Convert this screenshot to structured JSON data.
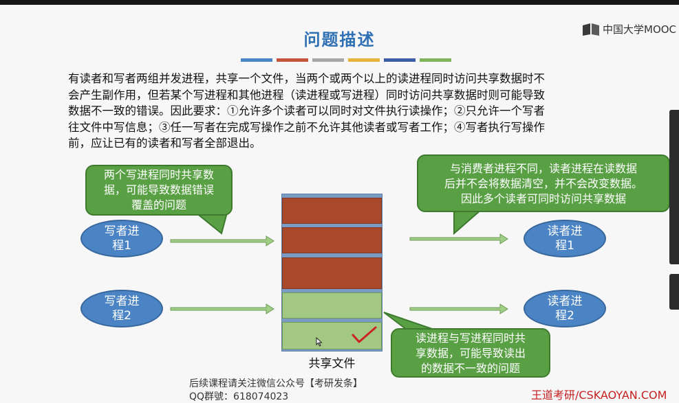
{
  "logo": {
    "text": "中国大学MOOC",
    "icon": "mooc-logo-icon"
  },
  "slide": {
    "title": "问题描述",
    "color_bar": [
      "#4a86c5",
      "#c5553a",
      "#a7a7a7",
      "#e6b33b",
      "#3c5fa8",
      "#7fb55a"
    ],
    "description": [
      "有读者和写者两组并发进程，共享一个文件，当两个或两个以上的读进程同时访问共享数据时不",
      "会产生副作用，但若某个写进程和其他进程（读进程或写进程）同时访问共享数据时则可能导致",
      "数据不一致的错误。因此要求：①允许多个读者可以同时对文件执行读操作；②只允许一个写者",
      "往文件中写信息；③任一写者在完成写操作之前不允许其他读者或写者工作；④写者执行写操作",
      "前，应让已有的读者和写者全部退出。"
    ],
    "bubbles": {
      "writers_conflict": [
        "两个写进程同时共享数",
        "据，可能导致数据错误",
        "覆盖的问题"
      ],
      "readers_share": [
        "与消费者进程不同，读者进程在读数据",
        "后并不会将数据清空，并不会改变数据。",
        "因此多个读者可同时访问共享数据"
      ],
      "read_write_conflict": [
        "读进程与写进程同时共",
        "享数据，可能导致读出",
        "的数据不一致的问题"
      ]
    },
    "processes": {
      "writer1": [
        "写者进",
        "程1"
      ],
      "writer2": [
        "写者进",
        "程2"
      ],
      "reader1": [
        "读者进",
        "程1"
      ],
      "reader2": [
        "读者进",
        "程2"
      ]
    },
    "shared_file_label": "共享文件",
    "check_mark": "✓",
    "footer": [
      "后续课程请关注微信公众号【考研发条】",
      "QQ群號：618074023"
    ],
    "watermark": "王道考研/CSKAOYAN.COM",
    "colors": {
      "title": "#2f6fb3",
      "bubble": "#59a045",
      "ellipse": "#4b84c4",
      "block_red": "#a9492b",
      "block_green": "#a3c884",
      "arrow": "#9fcf86",
      "check": "#cc2222"
    }
  }
}
